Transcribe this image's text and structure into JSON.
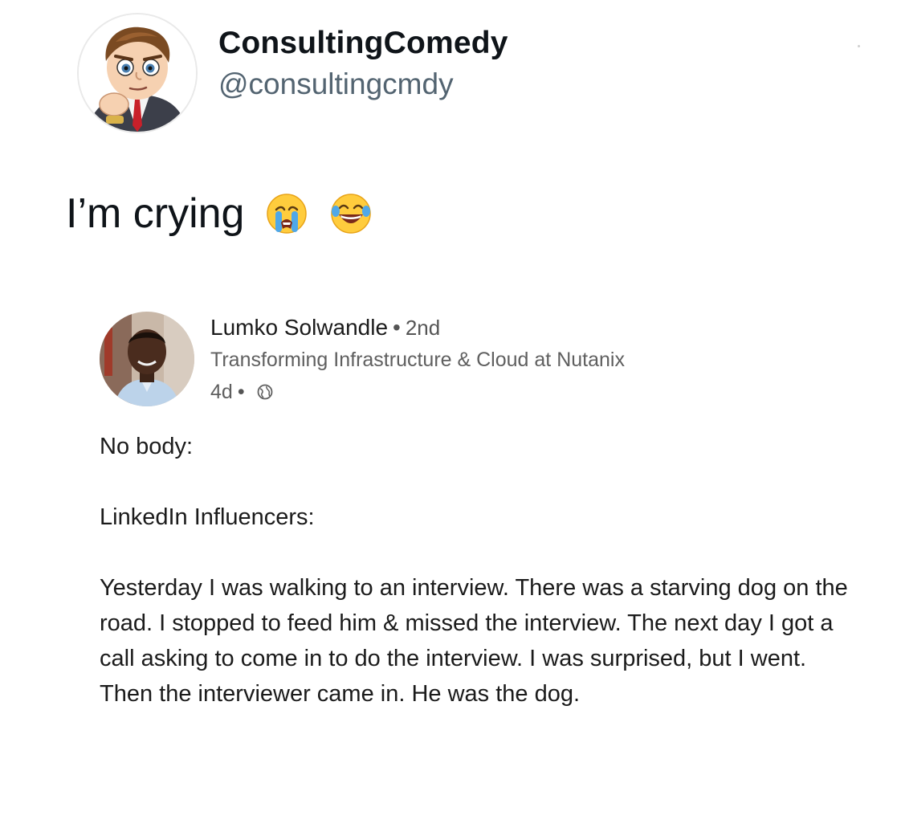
{
  "tweet": {
    "display_name": "ConsultingComedy",
    "handle": "@consultingcmdy",
    "text": "I’m crying",
    "emojis": [
      "loudly-crying-face",
      "face-with-tears-of-joy"
    ]
  },
  "linkedin_post": {
    "author_name": "Lumko Solwandle",
    "separator": "•",
    "degree": "2nd",
    "headline": "Transforming Infrastructure & Cloud at Nutanix",
    "time": "4d",
    "time_separator": "•",
    "visibility_icon": "globe-icon",
    "body_line_1": "No body:",
    "body_line_2": "LinkedIn Influencers:",
    "body_story": "Yesterday I was walking to an interview. There was a starving dog on the road. I stopped to feed him & missed the interview. The next day I got a call asking to come in to do the interview. I was surprised, but I went. Then the interviewer came in. He was the dog."
  },
  "colors": {
    "name": "#0f1419",
    "handle": "#536471",
    "li_text": "#1b1b1b",
    "li_secondary": "#5f5f5f"
  }
}
